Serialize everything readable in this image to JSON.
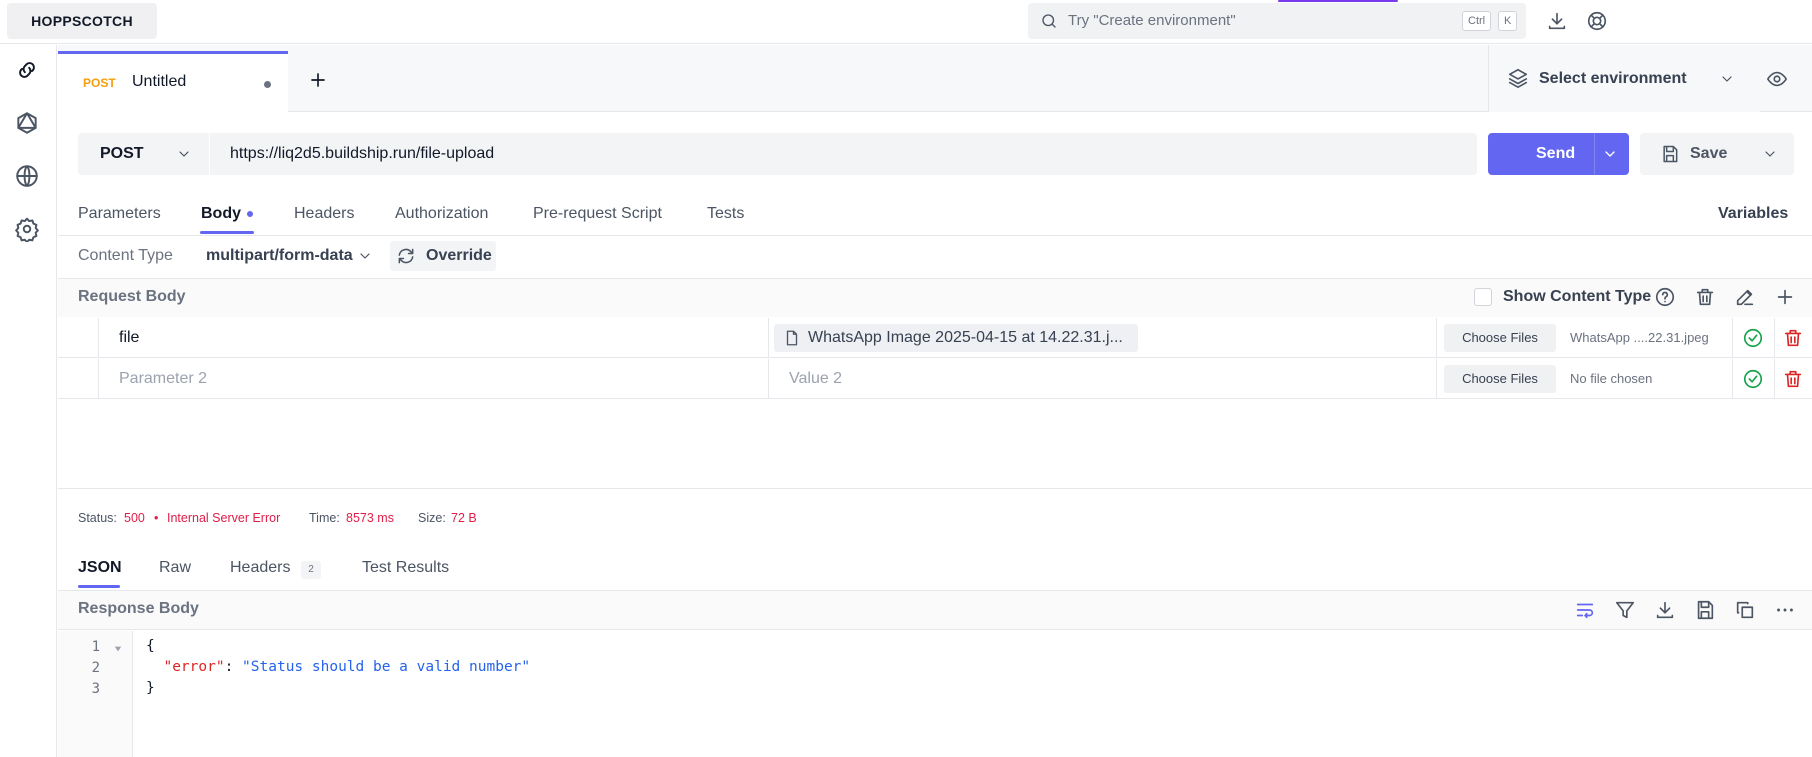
{
  "app": {
    "logo": "HOPPSCOTCH"
  },
  "search": {
    "placeholder": "Try \"Create environment\"",
    "kbd1": "Ctrl",
    "kbd2": "K"
  },
  "tab": {
    "method": "POST",
    "name": "Untitled"
  },
  "environment": {
    "label": "Select environment"
  },
  "request": {
    "method": "POST",
    "url": "https://liq2d5.buildship.run/file-upload",
    "send_label": "Send",
    "save_label": "Save"
  },
  "request_tabs": [
    "Parameters",
    "Body",
    "Headers",
    "Authorization",
    "Pre-request Script",
    "Tests"
  ],
  "variables_label": "Variables",
  "content_type": {
    "label": "Content Type",
    "value": "multipart/form-data",
    "override_label": "Override"
  },
  "request_body": {
    "label": "Request Body",
    "show_content_type": "Show Content Type",
    "rows": [
      {
        "key": "file",
        "value": "WhatsApp Image 2025-04-15 at 14.22.31.j...",
        "choose_label": "Choose Files",
        "file_name": "WhatsApp ....22.31.jpeg"
      },
      {
        "key_placeholder": "Parameter 2",
        "value_placeholder": "Value 2",
        "choose_label": "Choose Files",
        "file_name": "No file chosen"
      }
    ]
  },
  "response": {
    "status_label": "Status:",
    "status_code": "500",
    "status_text": "Internal Server Error",
    "time_label": "Time:",
    "time_value": "8573 ms",
    "size_label": "Size:",
    "size_value": "72 B",
    "tabs": [
      "JSON",
      "Raw",
      "Headers",
      "Test Results"
    ],
    "headers_count": "2",
    "body_label": "Response Body",
    "code": {
      "line1": "{",
      "key": "\"error\"",
      "colon": ": ",
      "value": "\"Status should be a valid number\"",
      "line3": "}"
    },
    "line_numbers": [
      "1",
      "2",
      "3"
    ]
  },
  "colors": {
    "accent": "#6366f1",
    "error": "#e11d48",
    "method": "#f59e0b"
  }
}
